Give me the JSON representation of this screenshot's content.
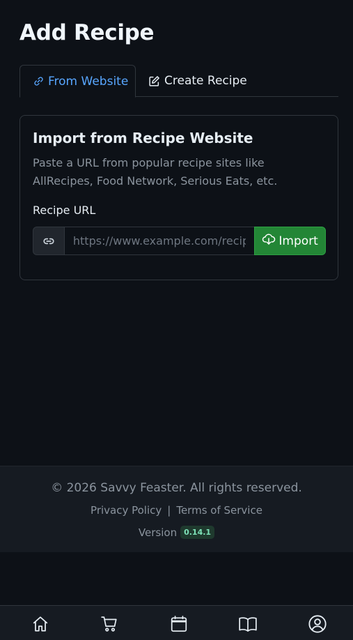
{
  "page": {
    "title": "Add Recipe"
  },
  "tabs": [
    {
      "label": "From Website",
      "icon": "link-icon",
      "active": true
    },
    {
      "label": "Create Recipe",
      "icon": "edit-icon",
      "active": false
    }
  ],
  "card": {
    "title": "Import from Recipe Website",
    "description": "Paste a URL from popular recipe sites like AllRecipes, Food Network, Serious Eats, etc.",
    "field_label": "Recipe URL",
    "input": {
      "value": "",
      "placeholder": "https://www.example.com/recipe",
      "prefix_icon": "link-icon"
    },
    "import_button": {
      "label": "Import",
      "icon": "cloud-download-icon"
    }
  },
  "footer": {
    "copyright": "© 2026 Savvy Feaster. All rights reserved.",
    "links": [
      "Privacy Policy",
      "Terms of Service"
    ],
    "separator": "|",
    "version_label": "Version",
    "version": "0.14.1"
  },
  "bottom_nav": [
    {
      "icon": "home-icon"
    },
    {
      "icon": "cart-icon"
    },
    {
      "icon": "calendar-icon"
    },
    {
      "icon": "book-icon"
    },
    {
      "icon": "profile-icon"
    }
  ],
  "colors": {
    "background": "#0d1117",
    "accent": "#58a6ff",
    "import_button": "#238636",
    "badge_bg": "#1f3a2e",
    "badge_text": "#7ee2b8"
  }
}
